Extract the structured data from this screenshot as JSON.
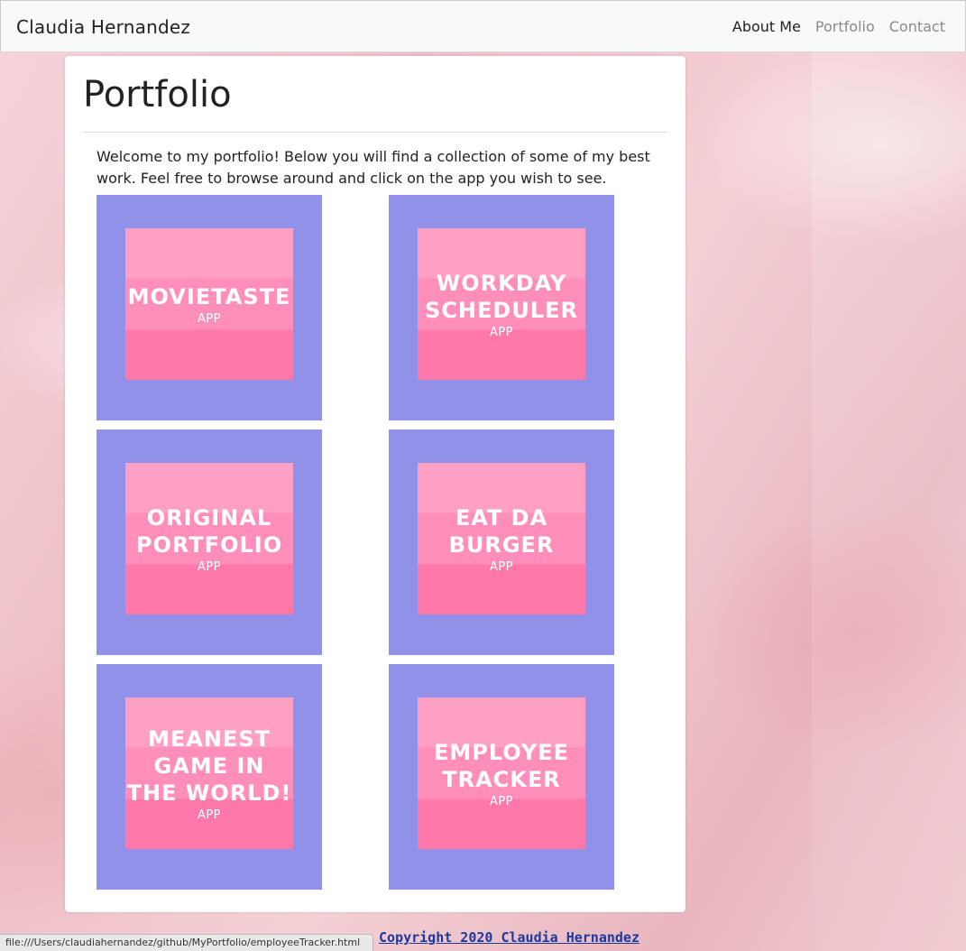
{
  "navbar": {
    "brand": "Claudia Hernandez",
    "links": [
      {
        "label": "About Me",
        "active": true
      },
      {
        "label": "Portfolio",
        "active": false
      },
      {
        "label": "Contact",
        "active": false
      }
    ]
  },
  "main": {
    "title": "Portfolio",
    "intro": "Welcome to my portfolio! Below you will find a collection of some of my best work. Feel free to browse around and click on the app you wish to see.",
    "projects": [
      {
        "title": "MOVIETASTE",
        "subtitle": "APP"
      },
      {
        "title": "WORKDAY SCHEDULER",
        "subtitle": "APP"
      },
      {
        "title": "ORIGINAL PORTFOLIO",
        "subtitle": "APP"
      },
      {
        "title": "EAT DA BURGER",
        "subtitle": "APP"
      },
      {
        "title": "MEANEST GAME IN THE WORLD!",
        "subtitle": "APP"
      },
      {
        "title": "EMPLOYEE TRACKER",
        "subtitle": "APP"
      }
    ]
  },
  "footer": {
    "text": "Copyright 2020 Claudia Hernandez"
  },
  "status_bar": {
    "url": "file:///Users/claudiahernandez/github/MyPortfolio/employeeTracker.html"
  },
  "colors": {
    "tile_background": "#9191ea",
    "tile_pink_light": "#ff9fc4",
    "tile_pink_dark": "#ff78a9"
  }
}
